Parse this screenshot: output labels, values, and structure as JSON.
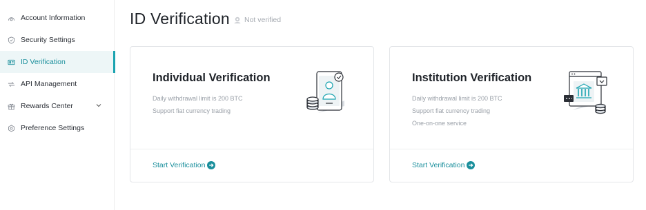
{
  "sidebar": {
    "items": [
      {
        "label": "Account Information",
        "icon": "account-icon"
      },
      {
        "label": "Security Settings",
        "icon": "shield-icon"
      },
      {
        "label": "ID Verification",
        "icon": "id-card-icon",
        "active": true
      },
      {
        "label": "API Management",
        "icon": "api-icon"
      },
      {
        "label": "Rewards Center",
        "icon": "gift-icon",
        "expandable": true
      },
      {
        "label": "Preference Settings",
        "icon": "gear-icon"
      }
    ]
  },
  "header": {
    "title": "ID Verification",
    "status": "Not verified",
    "status_icon": "user-badge-icon"
  },
  "cards": [
    {
      "title": "Individual Verification",
      "features": [
        "Daily withdrawal limit is 200 BTC",
        "Support fiat currency trading"
      ],
      "cta": "Start Verification",
      "illustration": "person-id-phone-illustration"
    },
    {
      "title": "Institution Verification",
      "features": [
        "Daily withdrawal limit is 200 BTC",
        "Support fiat currency trading",
        "One-on-one service"
      ],
      "cta": "Start Verification",
      "illustration": "bank-building-illustration"
    }
  ],
  "colors": {
    "accent": "#1aa3b0",
    "accent_text": "#1a8f9c",
    "active_bg": "#edf6f7",
    "muted": "#9aa0a8"
  }
}
